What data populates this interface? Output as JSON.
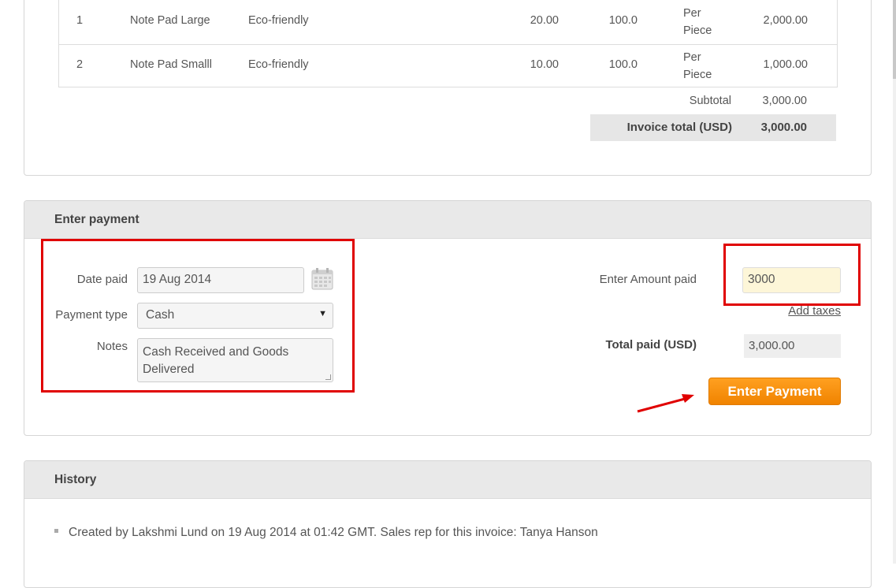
{
  "invoice": {
    "items": [
      {
        "num": "1",
        "name": "Note Pad Large",
        "description": "Eco-friendly",
        "quantity": "20.00",
        "price": "100.0",
        "unit_line1": "Per",
        "unit_line2": "Piece",
        "total": "2,000.00"
      },
      {
        "num": "2",
        "name": "Note Pad Smalll",
        "description": "Eco-friendly",
        "quantity": "10.00",
        "price": "100.0",
        "unit_line1": "Per",
        "unit_line2": "Piece",
        "total": "1,000.00"
      }
    ],
    "subtotal_label": "Subtotal",
    "subtotal_value": "3,000.00",
    "invoice_total_label": "Invoice total (USD)",
    "invoice_total_value": "3,000.00"
  },
  "payment": {
    "title": "Enter payment",
    "date_paid_label": "Date paid",
    "date_paid_value": "19 Aug 2014",
    "payment_type_label": "Payment type",
    "payment_type_value": "Cash",
    "notes_label": "Notes",
    "notes_value": "Cash Received and Goods Delivered",
    "amount_label": "Enter Amount paid",
    "amount_value": "3000",
    "add_taxes_label": "Add taxes",
    "total_paid_label": "Total paid (USD)",
    "total_paid_value": "3,000.00",
    "submit_label": "Enter Payment"
  },
  "history": {
    "title": "History",
    "entries": [
      "Created by Lakshmi Lund on 19 Aug 2014 at 01:42 GMT. Sales rep for this invoice: Tanya Hanson"
    ]
  },
  "colors": {
    "annotation_red": "#e00000",
    "button_orange": "#f08300",
    "amount_highlight": "#fdf6d8"
  },
  "icons": {
    "calendar": "calendar-icon",
    "select_caret": "caret-down-icon",
    "annotation": "arrow-icon"
  }
}
